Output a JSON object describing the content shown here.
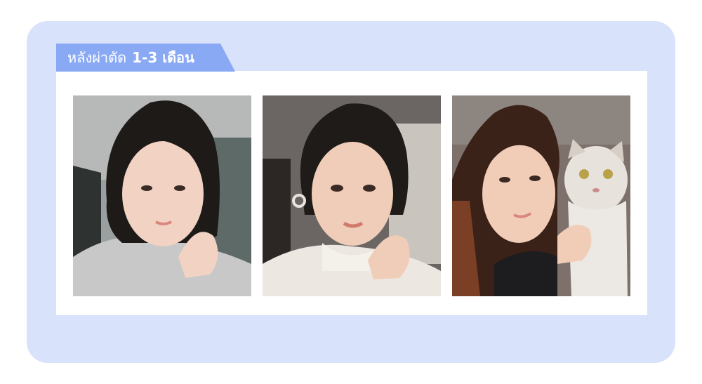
{
  "header": {
    "label_regular": "หลังผ่าตัด",
    "label_bold": "1-3 เดือน"
  },
  "photos": [
    {
      "icon": "portrait-photo"
    },
    {
      "icon": "portrait-photo"
    },
    {
      "icon": "portrait-photo-with-cat"
    }
  ],
  "colors": {
    "card_bg": "#d9e2fb",
    "tab_bg": "#8aa9f5",
    "panel_bg": "#ffffff"
  }
}
